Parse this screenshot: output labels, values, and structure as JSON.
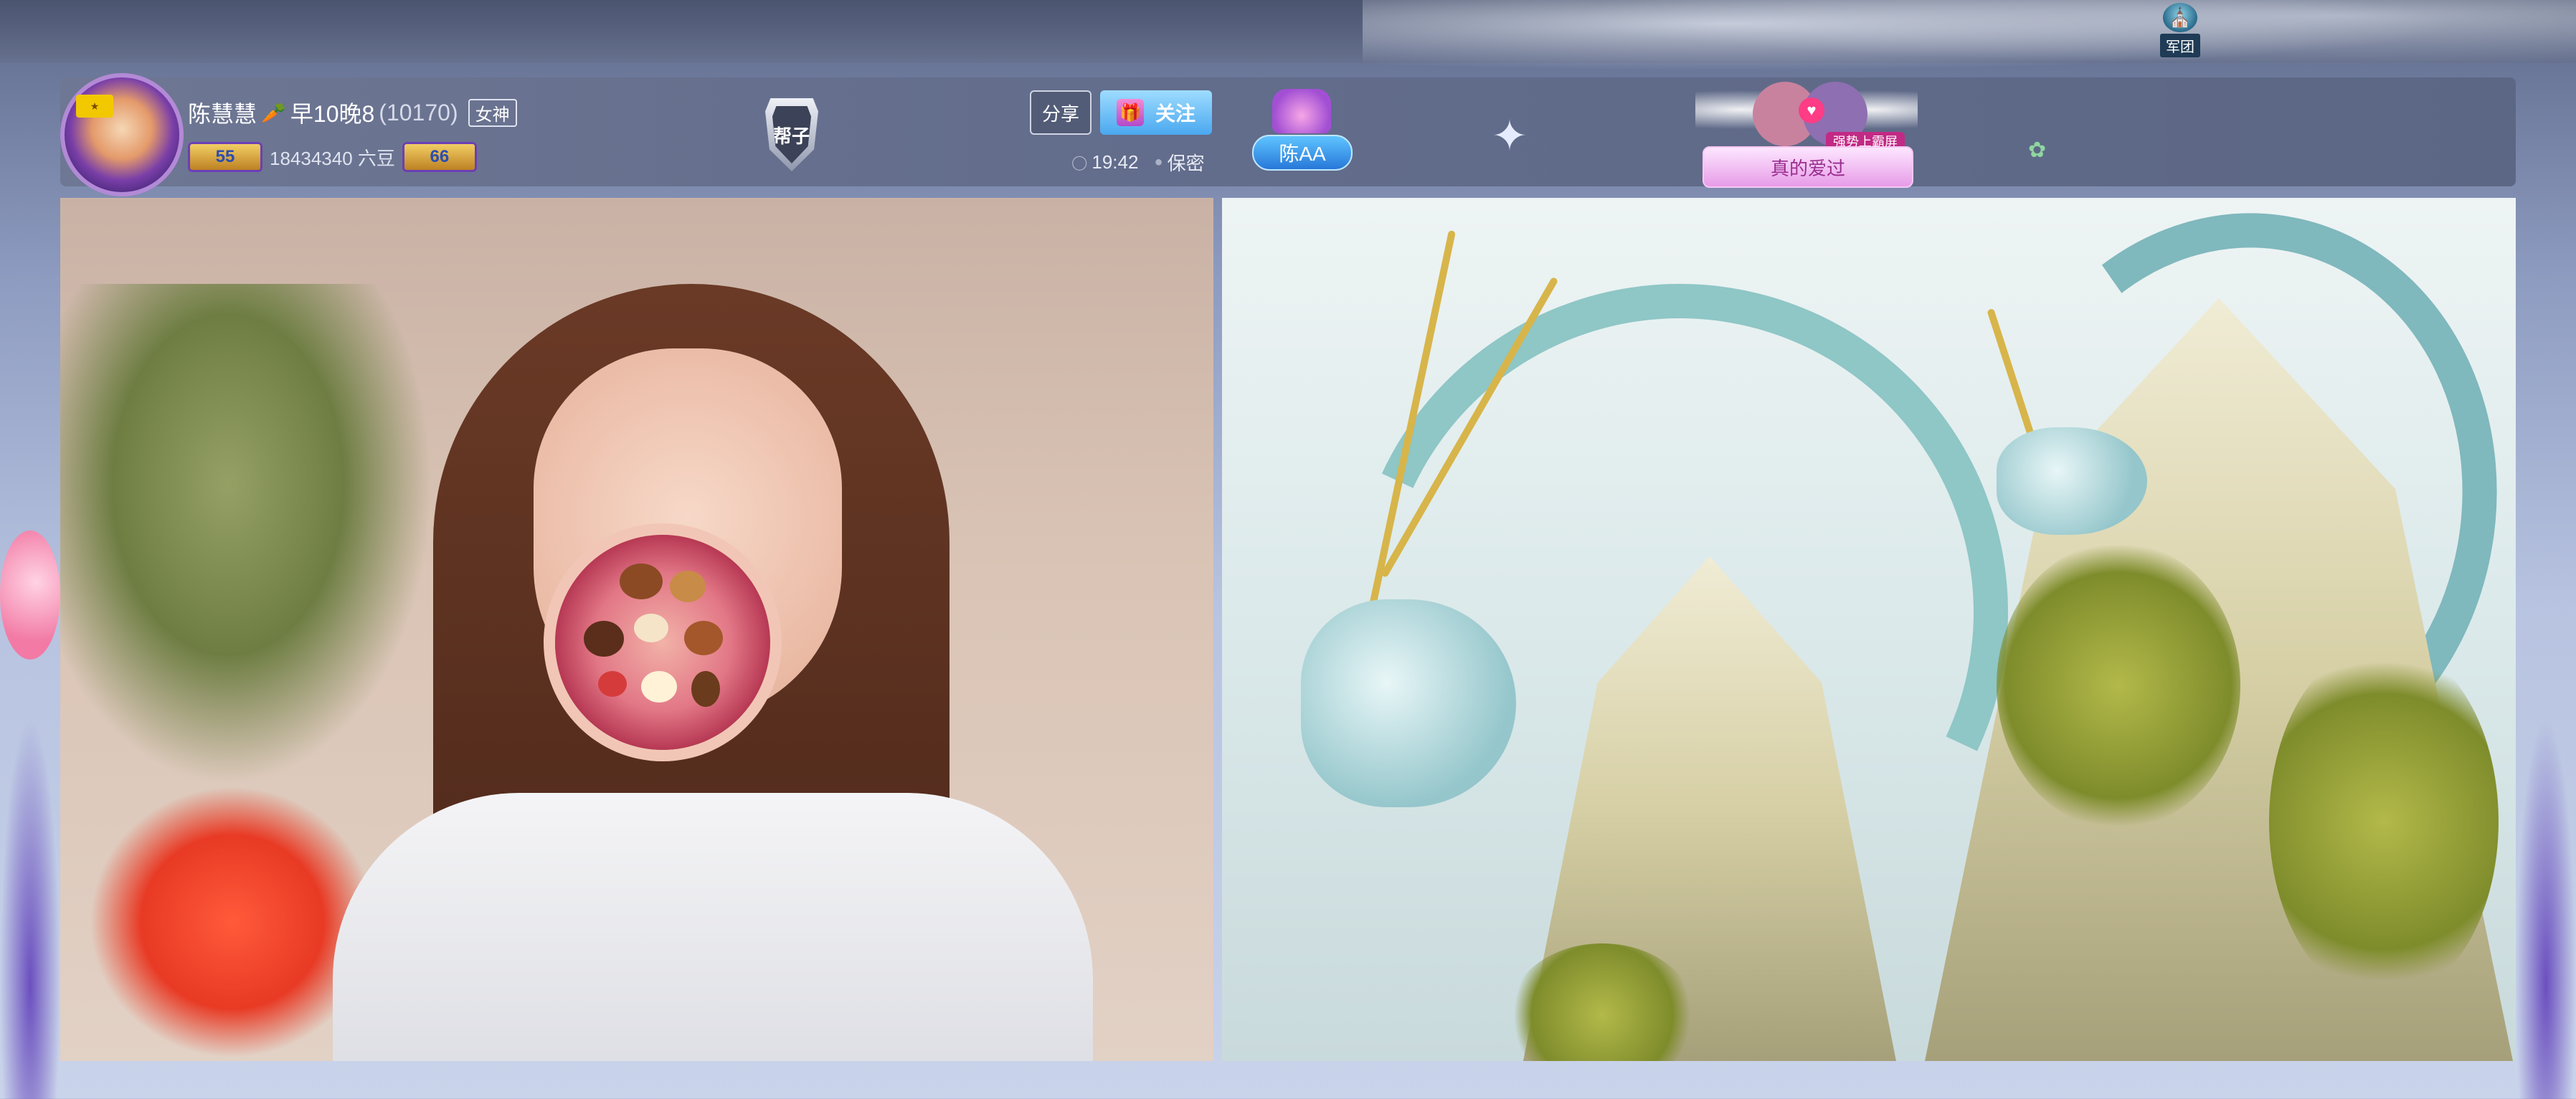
{
  "top_bar": {
    "team_label": "军团"
  },
  "streamer": {
    "name": "陈慧慧",
    "schedule": "早10晚8",
    "room_id": "(10170)",
    "tag": "女神",
    "level_badge_left": "55",
    "beans": "18434340 六豆",
    "level_badge_right": "66"
  },
  "shield_badge": "帮子",
  "actions": {
    "share_label": "分享",
    "follow_label": "关注"
  },
  "meta": {
    "time": "19:42",
    "location": "保密"
  },
  "guard": {
    "name": "陈AA"
  },
  "banner": {
    "small_text": "强势上霸屏",
    "main_text": "真的爱过"
  },
  "icons": {
    "team": "team-helmet-icon",
    "carrot": "carrot-icon",
    "gift": "gift-icon",
    "clock": "clock-icon",
    "location": "location-pin-icon",
    "bird": "bird-icon",
    "heart": "heart-icon"
  },
  "colors": {
    "follow_button": "#4aa8ef",
    "header_bg": "#636d8c",
    "guard_pill": "#2778d9"
  }
}
